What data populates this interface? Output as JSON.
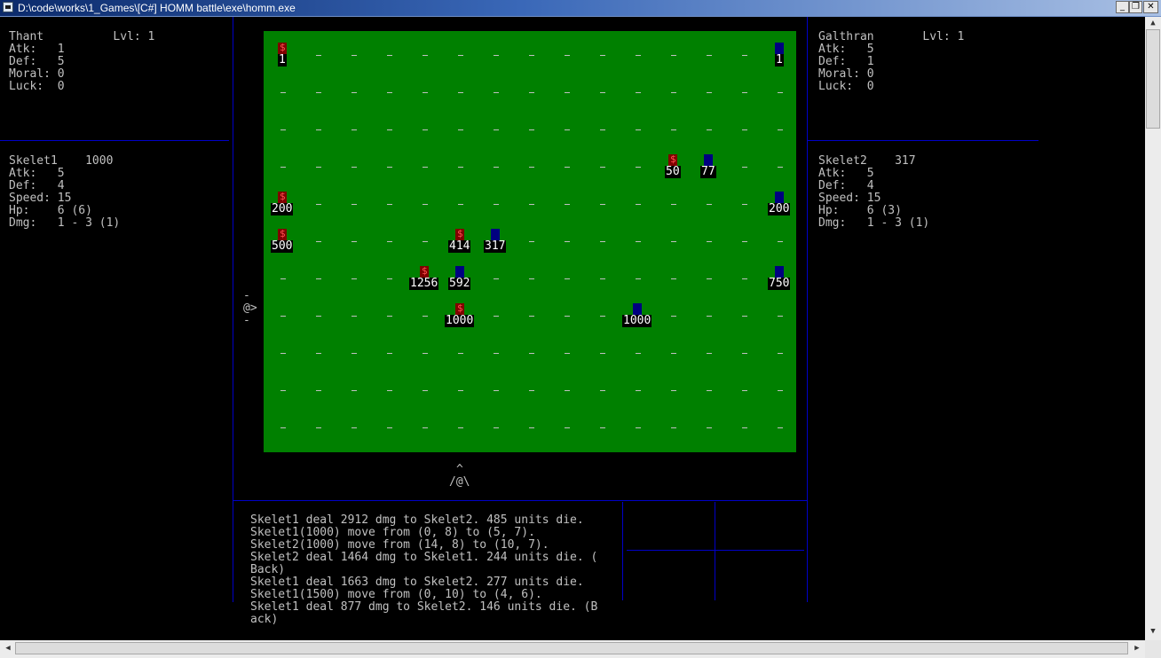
{
  "window": {
    "title": "D:\\code\\works\\1_Games\\[C#] HOMM battle\\exe\\homm.exe",
    "minimize_glyph": "_",
    "restore_glyph": "❐",
    "close_glyph": "✕"
  },
  "left_hero": {
    "line1": "Thant          Lvl: 1",
    "line2": "Atk:   1",
    "line3": "Def:   5",
    "line4": "Moral: 0",
    "line5": "Luck:  0"
  },
  "right_hero": {
    "line1": "Galthran       Lvl: 1",
    "line2": "Atk:   5",
    "line3": "Def:   1",
    "line4": "Moral: 0",
    "line5": "Luck:  0"
  },
  "left_unit": {
    "line1": "Skelet1    1000",
    "line2": "Atk:   5",
    "line3": "Def:   4",
    "line4": "Speed: 15",
    "line5": "Hp:    6 (6)",
    "line6": "Dmg:   1 - 3 (1)"
  },
  "right_unit": {
    "line1": "Skelet2    317",
    "line2": "Atk:   5",
    "line3": "Def:   4",
    "line4": "Speed: 15",
    "line5": "Hp:    6 (3)",
    "line6": "Dmg:   1 - 3 (1)"
  },
  "cursors": {
    "left_top": "-",
    "left_mid": "@>",
    "left_bot": "-",
    "bottom_top": "^",
    "bottom_mid": "/@\\"
  },
  "board": {
    "empty_cell": "_",
    "unit_glyph": "$",
    "stacks": [
      {
        "army": "red",
        "count": "1"
      },
      {
        "army": "blue",
        "count": "1"
      },
      {
        "army": "red",
        "count": "50"
      },
      {
        "army": "blue",
        "count": "77"
      },
      {
        "army": "red",
        "count": "200"
      },
      {
        "army": "blue",
        "count": "200"
      },
      {
        "army": "red",
        "count": "500"
      },
      {
        "army": "red",
        "count": "414"
      },
      {
        "army": "blue",
        "count": "317"
      },
      {
        "army": "red",
        "count": "1256"
      },
      {
        "army": "blue",
        "count": "592"
      },
      {
        "army": "blue",
        "count": "750"
      },
      {
        "army": "red",
        "count": "1000"
      },
      {
        "army": "blue",
        "count": "1000"
      }
    ]
  },
  "log": [
    "Skelet1 deal 2912 dmg to Skelet2. 485 units die.",
    "Skelet1(1000) move from (0, 8) to (5, 7).",
    "Skelet2(1000) move from (14, 8) to (10, 7).",
    "Skelet2 deal 1464 dmg to Skelet1. 244 units die. (",
    "Back)",
    "Skelet1 deal 1663 dmg to Skelet2. 277 units die.",
    "Skelet1(1500) move from (0, 10) to (4, 6).",
    "Skelet1 deal 877 dmg to Skelet2. 146 units die. (B",
    "ack)"
  ],
  "scroll_arrows": {
    "up": "▲",
    "down": "▼",
    "left": "◀",
    "right": "▶"
  },
  "colors": {
    "console_bg": "#000000",
    "console_text": "#c0c0c0",
    "field_green": "#008000",
    "divider_blue": "#0000c8",
    "red_army": "#800000",
    "blue_army": "#000080"
  }
}
